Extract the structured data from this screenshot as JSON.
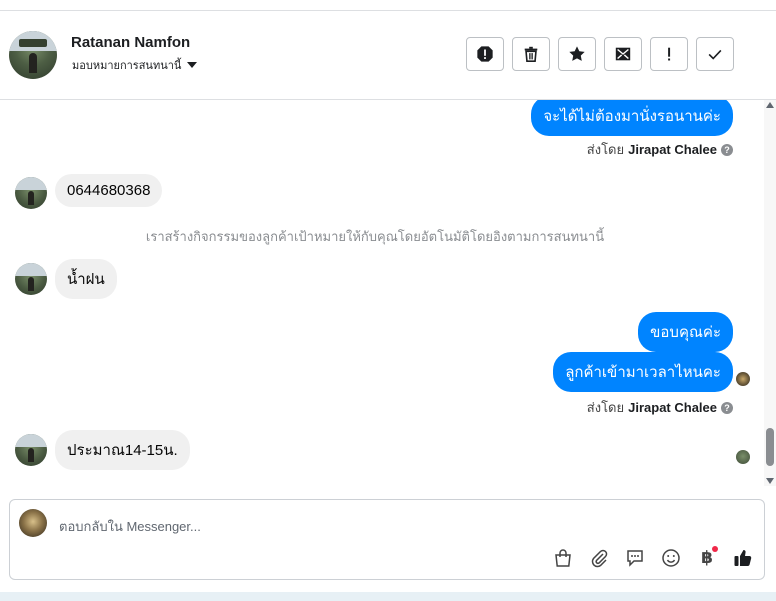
{
  "header": {
    "contact_name": "Ratanan Namfon",
    "assign_label": "มอบหมายการสนทนานี้",
    "actions": [
      {
        "name": "report-spam-button",
        "icon": "alert-circle-icon"
      },
      {
        "name": "delete-button",
        "icon": "trash-icon"
      },
      {
        "name": "star-button",
        "icon": "star-icon"
      },
      {
        "name": "mark-unread-button",
        "icon": "envelope-open-icon"
      },
      {
        "name": "follow-up-button",
        "icon": "exclamation-icon"
      },
      {
        "name": "mark-done-button",
        "icon": "check-icon"
      }
    ]
  },
  "thread": {
    "messages": [
      {
        "from": "page",
        "text": "จะได้ไม่ต้องมานั่งรอนานค่ะ"
      },
      {
        "sent_by_prefix": "ส่งโดย",
        "sent_by_name": "Jirapat Chalee"
      },
      {
        "from": "customer",
        "text": "0644680368"
      },
      {
        "system": "เราสร้างกิจกรรมของลูกค้าเป้าหมายให้กับคุณโดยอัตโนมัติโดยอิงตามการสนทนานี้"
      },
      {
        "from": "customer",
        "text": "น้ำฝน"
      },
      {
        "from": "page",
        "text": "ขอบคุณค่ะ"
      },
      {
        "from": "page",
        "text": "ลูกค้าเข้ามาเวลาไหนคะ"
      },
      {
        "sent_by_prefix": "ส่งโดย",
        "sent_by_name": "Jirapat Chalee"
      },
      {
        "from": "customer",
        "text": "ประมาณ14-15น."
      }
    ],
    "help_glyph": "?"
  },
  "composer": {
    "placeholder": "ตอบกลับใน Messenger...",
    "currency_glyph": "฿",
    "tools": [
      "shopping-bag-icon",
      "paperclip-icon",
      "saved-reply-icon",
      "emoji-icon",
      "payment-icon",
      "like-icon"
    ]
  },
  "colors": {
    "outgoing_bubble": "#0084ff",
    "incoming_bubble": "#f0f0f0",
    "notification_dot": "#f02849"
  }
}
